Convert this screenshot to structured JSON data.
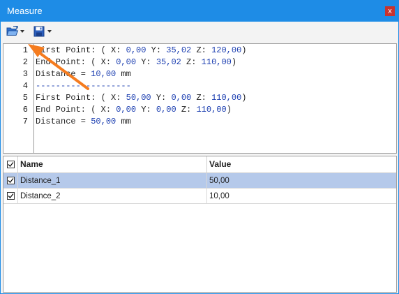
{
  "window": {
    "title": "Measure",
    "close_glyph": "x"
  },
  "toolbar": {
    "open_icon": "folder-open-icon",
    "save_icon": "save-icon"
  },
  "editor": {
    "line_numbers": [
      "1",
      "2",
      "3",
      "4",
      "5",
      "6",
      "7"
    ],
    "lines": [
      "First Point: ( X: 0,00 Y: 35,02 Z: 120,00)",
      "End Point: ( X: 0,00 Y: 35,02 Z: 110,00)",
      "Distance = 10,00 mm",
      "-------------------",
      "First Point: ( X: 50,00 Y: 0,00 Z: 110,00)",
      "End Point: ( X: 0,00 Y: 0,00 Z: 110,00)",
      "Distance = 50,00 mm"
    ]
  },
  "table": {
    "headers": {
      "name": "Name",
      "value": "Value"
    },
    "header_checked": true,
    "rows": [
      {
        "name": "Distance_1",
        "value": "50,00",
        "checked": true,
        "selected": true
      },
      {
        "name": "Distance_2",
        "value": "10,00",
        "checked": true,
        "selected": false
      }
    ]
  },
  "annotation": {
    "color": "#f57c1f"
  },
  "colors": {
    "titlebar": "#1e8ce6",
    "selection": "#b5c9ea",
    "number": "#1a3db0"
  }
}
